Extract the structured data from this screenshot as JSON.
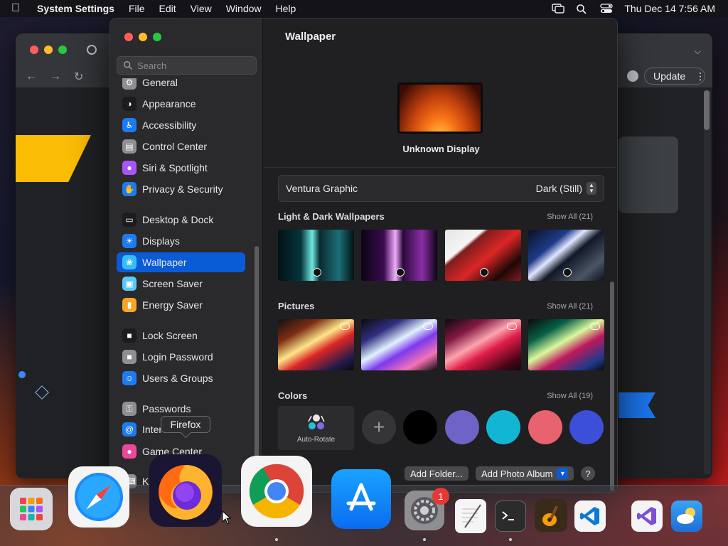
{
  "menubar": {
    "app_name": "System Settings",
    "menus": [
      "File",
      "Edit",
      "View",
      "Window",
      "Help"
    ],
    "clock": "Thu Dec 14  7:56 AM"
  },
  "chrome": {
    "update_label": "Update"
  },
  "settings": {
    "search_placeholder": "Search",
    "sidebar": [
      {
        "label": "General",
        "icon": "gear-icon",
        "color": "#8e8e93"
      },
      {
        "label": "Appearance",
        "icon": "appearance-icon",
        "color": "#1c1c1e"
      },
      {
        "label": "Accessibility",
        "icon": "accessibility-icon",
        "color": "#1d7bf2"
      },
      {
        "label": "Control Center",
        "icon": "control-center-icon",
        "color": "#8e8e93"
      },
      {
        "label": "Siri & Spotlight",
        "icon": "siri-icon",
        "color": "#a855f7"
      },
      {
        "label": "Privacy & Security",
        "icon": "hand-icon",
        "color": "#1d7bf2"
      },
      {
        "label": "Desktop & Dock",
        "icon": "dock-icon",
        "color": "#1c1c1e"
      },
      {
        "label": "Displays",
        "icon": "displays-icon",
        "color": "#1d7bf2"
      },
      {
        "label": "Wallpaper",
        "icon": "wallpaper-icon",
        "color": "#38bdf8"
      },
      {
        "label": "Screen Saver",
        "icon": "screen-saver-icon",
        "color": "#5ac8fa"
      },
      {
        "label": "Energy Saver",
        "icon": "battery-icon",
        "color": "#f5a623"
      },
      {
        "label": "Lock Screen",
        "icon": "lock-icon",
        "color": "#1c1c1e"
      },
      {
        "label": "Login Password",
        "icon": "lock-icon",
        "color": "#8e8e93"
      },
      {
        "label": "Users & Groups",
        "icon": "users-icon",
        "color": "#1d7bf2"
      },
      {
        "label": "Passwords",
        "icon": "key-icon",
        "color": "#8e8e93"
      },
      {
        "label": "Inter",
        "icon": "at-icon",
        "color": "#1d7bf2"
      },
      {
        "label": "Game Center",
        "icon": "game-center-icon",
        "color": "#ec4899"
      },
      {
        "label": "Ke",
        "icon": "keyboard-icon",
        "color": "#8e8e93"
      }
    ],
    "selected": "Wallpaper",
    "main": {
      "title": "Wallpaper",
      "display_name": "Unknown Display",
      "current_wallpaper": "Ventura Graphic",
      "mode": "Dark (Still)",
      "sections": {
        "light_dark": {
          "title": "Light & Dark Wallpapers",
          "show_all": "Show All (21)"
        },
        "pictures": {
          "title": "Pictures",
          "show_all": "Show All (21)"
        },
        "colors": {
          "title": "Colors",
          "show_all": "Show All (19)"
        }
      },
      "auto_rotate_label": "Auto-Rotate",
      "color_swatches": [
        "#000000",
        "#6e63c6",
        "#13b6d2",
        "#e8626f",
        "#3b4fd8"
      ],
      "add_folder": "Add Folder...",
      "add_photo_album": "Add Photo Album",
      "help": "?"
    }
  },
  "dock": {
    "tooltip": "Firefox",
    "badge_count": "1"
  },
  "colors": {
    "selection": "#0a5bd6",
    "window_bg": "#1f1f21",
    "sidebar_bg": "#2a2a2c"
  }
}
